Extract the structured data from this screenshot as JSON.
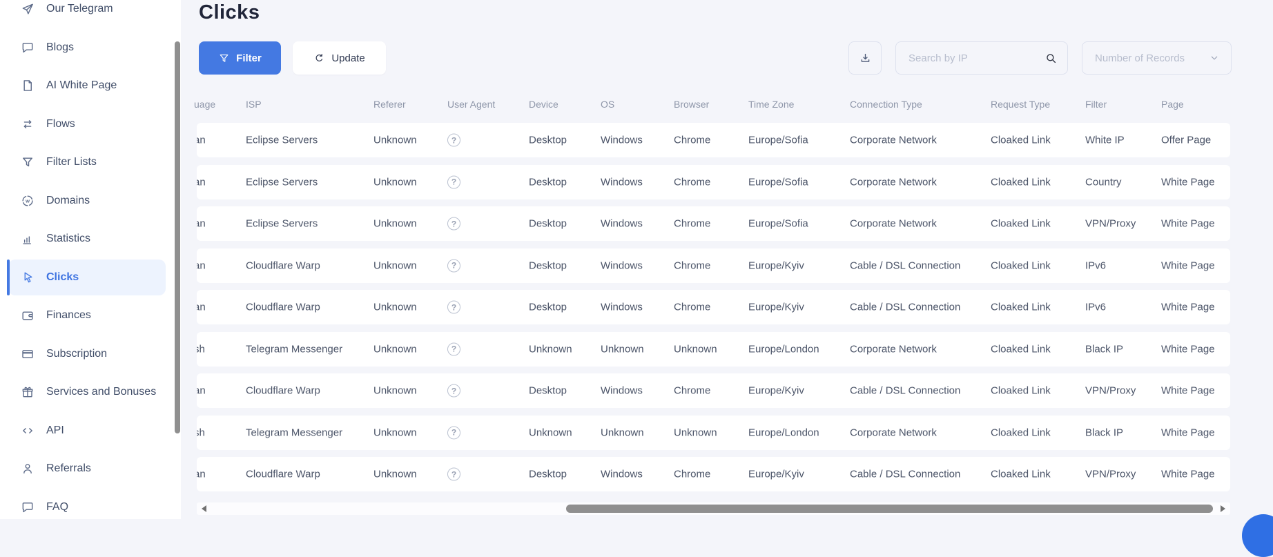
{
  "header": {
    "title": "Clicks"
  },
  "toolbar": {
    "filter_label": "Filter",
    "update_label": "Update",
    "search_placeholder": "Search by IP",
    "records_label": "Number of Records"
  },
  "sidebar": {
    "items": [
      {
        "label": "Our Telegram",
        "icon": "paper-plane",
        "active": false
      },
      {
        "label": "Blogs",
        "icon": "comment",
        "active": false
      },
      {
        "label": "AI White Page",
        "icon": "page",
        "active": false
      },
      {
        "label": "Flows",
        "icon": "flows",
        "active": false
      },
      {
        "label": "Filter Lists",
        "icon": "funnel",
        "active": false
      },
      {
        "label": "Domains",
        "icon": "globe",
        "active": false
      },
      {
        "label": "Statistics",
        "icon": "chart",
        "active": false
      },
      {
        "label": "Clicks",
        "icon": "cursor",
        "active": true
      },
      {
        "label": "Finances",
        "icon": "wallet",
        "active": false
      },
      {
        "label": "Subscription",
        "icon": "card",
        "active": false
      },
      {
        "label": "Services and Bonuses",
        "icon": "gift",
        "active": false
      },
      {
        "label": "API",
        "icon": "code",
        "active": false
      },
      {
        "label": "Referrals",
        "icon": "person",
        "active": false
      },
      {
        "label": "FAQ",
        "icon": "comment",
        "active": false
      }
    ]
  },
  "table": {
    "columns": [
      "uage",
      "ISP",
      "Referer",
      "User Agent",
      "Device",
      "OS",
      "Browser",
      "Time Zone",
      "Connection Type",
      "Request Type",
      "Filter",
      "Page"
    ],
    "user_agent_icon": "question-circle-icon",
    "rows": [
      {
        "lang": "an",
        "isp": "Eclipse Servers",
        "referer": "Unknown",
        "device": "Desktop",
        "os": "Windows",
        "browser": "Chrome",
        "tz": "Europe/Sofia",
        "conn": "Corporate Network",
        "req": "Cloaked Link",
        "filter": "White IP",
        "page": "Offer Page"
      },
      {
        "lang": "an",
        "isp": "Eclipse Servers",
        "referer": "Unknown",
        "device": "Desktop",
        "os": "Windows",
        "browser": "Chrome",
        "tz": "Europe/Sofia",
        "conn": "Corporate Network",
        "req": "Cloaked Link",
        "filter": "Country",
        "page": "White Page"
      },
      {
        "lang": "an",
        "isp": "Eclipse Servers",
        "referer": "Unknown",
        "device": "Desktop",
        "os": "Windows",
        "browser": "Chrome",
        "tz": "Europe/Sofia",
        "conn": "Corporate Network",
        "req": "Cloaked Link",
        "filter": "VPN/Proxy",
        "page": "White Page"
      },
      {
        "lang": "an",
        "isp": "Cloudflare Warp",
        "referer": "Unknown",
        "device": "Desktop",
        "os": "Windows",
        "browser": "Chrome",
        "tz": "Europe/Kyiv",
        "conn": "Cable / DSL Connection",
        "req": "Cloaked Link",
        "filter": "IPv6",
        "page": "White Page"
      },
      {
        "lang": "an",
        "isp": "Cloudflare Warp",
        "referer": "Unknown",
        "device": "Desktop",
        "os": "Windows",
        "browser": "Chrome",
        "tz": "Europe/Kyiv",
        "conn": "Cable / DSL Connection",
        "req": "Cloaked Link",
        "filter": "IPv6",
        "page": "White Page"
      },
      {
        "lang": "sh",
        "isp": "Telegram Messenger",
        "referer": "Unknown",
        "device": "Unknown",
        "os": "Unknown",
        "browser": "Unknown",
        "tz": "Europe/London",
        "conn": "Corporate Network",
        "req": "Cloaked Link",
        "filter": "Black IP",
        "page": "White Page"
      },
      {
        "lang": "an",
        "isp": "Cloudflare Warp",
        "referer": "Unknown",
        "device": "Desktop",
        "os": "Windows",
        "browser": "Chrome",
        "tz": "Europe/Kyiv",
        "conn": "Cable / DSL Connection",
        "req": "Cloaked Link",
        "filter": "VPN/Proxy",
        "page": "White Page"
      },
      {
        "lang": "sh",
        "isp": "Telegram Messenger",
        "referer": "Unknown",
        "device": "Unknown",
        "os": "Unknown",
        "browser": "Unknown",
        "tz": "Europe/London",
        "conn": "Corporate Network",
        "req": "Cloaked Link",
        "filter": "Black IP",
        "page": "White Page"
      },
      {
        "lang": "an",
        "isp": "Cloudflare Warp",
        "referer": "Unknown",
        "device": "Desktop",
        "os": "Windows",
        "browser": "Chrome",
        "tz": "Europe/Kyiv",
        "conn": "Cable / DSL Connection",
        "req": "Cloaked Link",
        "filter": "VPN/Proxy",
        "page": "White Page"
      }
    ]
  },
  "colors": {
    "page_background": "#f4f5fa",
    "sidebar_background": "#ffffff",
    "accent_blue": "#4479e2",
    "active_item_background": "#edf3fe",
    "active_item_text": "#3e73e1",
    "title_text": "#202539",
    "table_header_text": "#8e96a9",
    "cell_text": "#4b5468",
    "control_border": "#dde1ee",
    "placeholder_text": "#b7bdcd",
    "scrollbar_thumb": "#8f8f8f",
    "chat_bubble": "#2f6fe4"
  }
}
